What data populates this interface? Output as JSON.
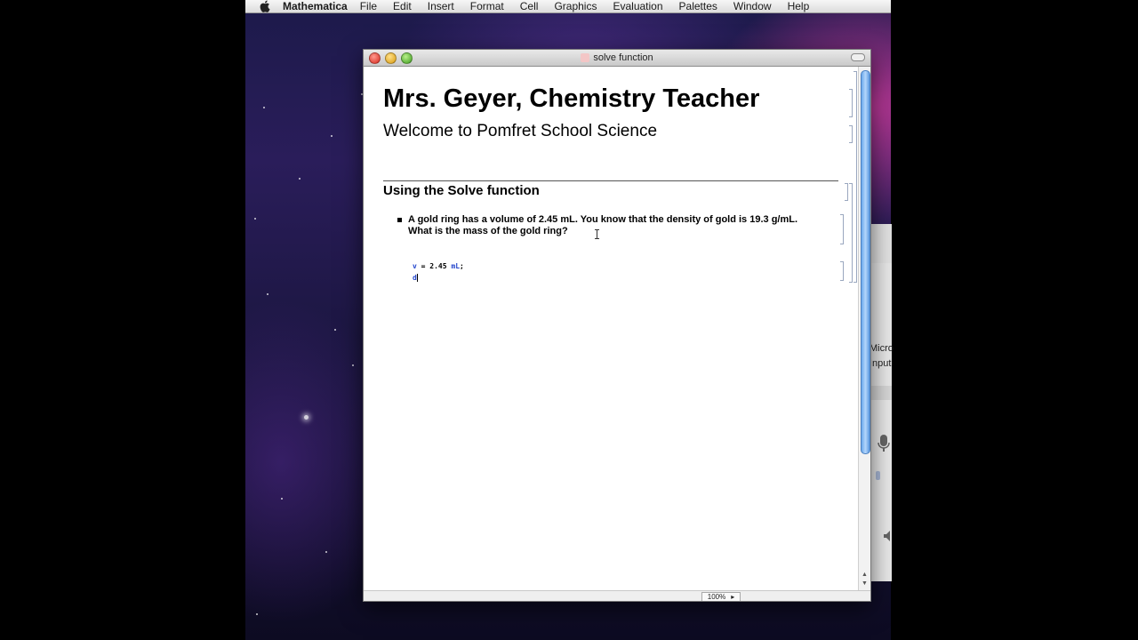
{
  "menubar": {
    "app_name": "Mathematica",
    "items": [
      "File",
      "Edit",
      "Insert",
      "Format",
      "Cell",
      "Graphics",
      "Evaluation",
      "Palettes",
      "Window",
      "Help"
    ]
  },
  "window": {
    "title": "solve function"
  },
  "notebook": {
    "title": "Mrs. Geyer, Chemistry Teacher",
    "subtitle": "Welcome to Pomfret School Science",
    "section": "Using the Solve function",
    "bullet_line1": "A gold ring has a volume of 2.45 mL.  You know that the density of gold is 19.3 g/mL.",
    "bullet_line2": "What is the mass of the gold ring?",
    "input_line1_var": "v",
    "input_line1_eq": " = ",
    "input_line1_num": "2.45",
    "input_line1_unit": "mL",
    "input_line1_end": ";",
    "input_line2": "d"
  },
  "statusbar": {
    "zoom": "100%"
  },
  "background_panel": {
    "text1": "Micro",
    "text2": "Input"
  }
}
